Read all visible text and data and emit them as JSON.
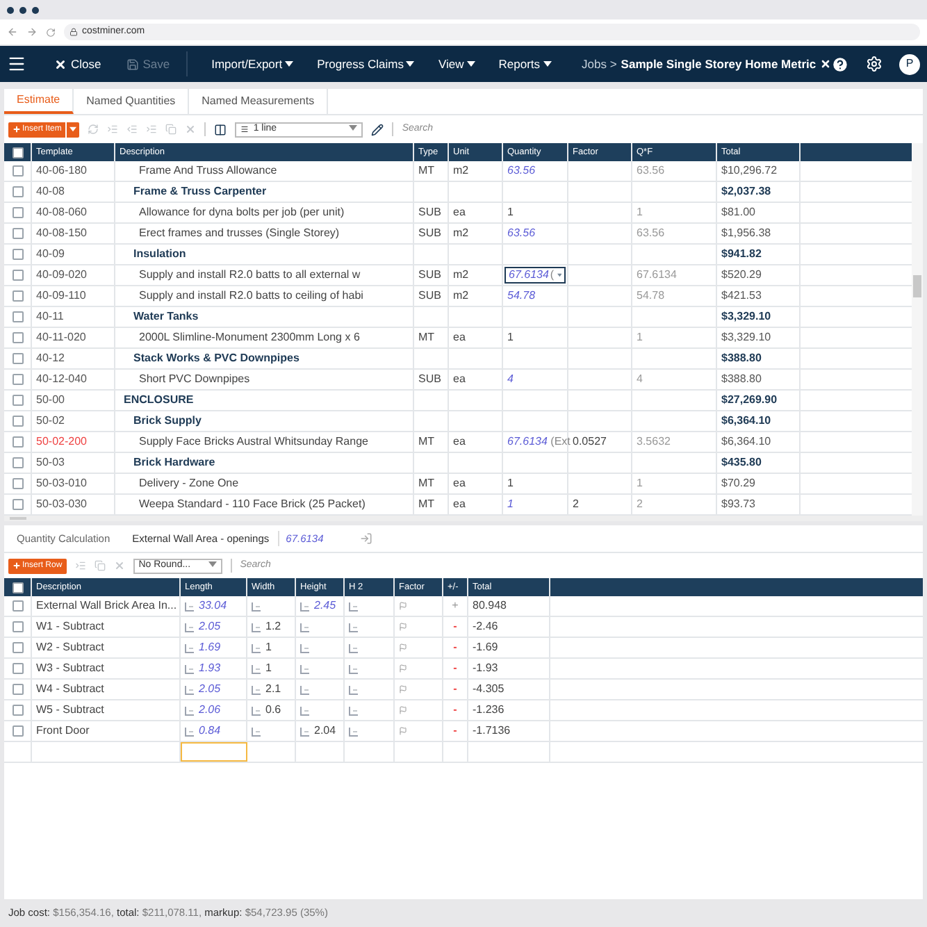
{
  "browser": {
    "url": "costminer.com"
  },
  "nav": {
    "close": "Close",
    "save": "Save",
    "save_disabled": true,
    "menus": [
      "Import/Export",
      "Progress Claims",
      "View",
      "Reports"
    ],
    "breadcrumb": "Jobs >",
    "job_title": "Sample Single Storey Home Metric",
    "avatar": "P"
  },
  "tabs": [
    {
      "label": "Estimate",
      "selected": true
    },
    {
      "label": "Named Quantities",
      "selected": false
    },
    {
      "label": "Named Measurements",
      "selected": false
    }
  ],
  "toolbar": {
    "insert": "Insert Item",
    "lines": "1 line",
    "search": {
      "placeholder": "Search"
    }
  },
  "table": {
    "columns": [
      "Template",
      "Description",
      "Type",
      "Unit",
      "Quantity",
      "Factor",
      "Q*F",
      "Total"
    ],
    "select_all_checked": false,
    "rows": [
      {
        "kind": "item",
        "checked": false,
        "template": "40-06-180",
        "description": "Frame And Truss Allowance",
        "type": "MT",
        "unit": "m2",
        "quantity": "63.56",
        "linked": true,
        "qf": "63.56",
        "total": "$10,296.72",
        "flagged": false,
        "editing": false
      },
      {
        "kind": "group",
        "checked": false,
        "template": "40-08",
        "description": "Frame & Truss Carpenter",
        "total": "$2,037.38",
        "flagged": false
      },
      {
        "kind": "item",
        "checked": false,
        "template": "40-08-060",
        "description": "Allowance for dyna bolts per job (per unit)",
        "type": "SUB",
        "unit": "ea",
        "quantity": "1",
        "linked": false,
        "qf": "1",
        "total": "$81.00",
        "flagged": false,
        "editing": false
      },
      {
        "kind": "item",
        "checked": false,
        "template": "40-08-150",
        "description": "Erect frames and trusses (Single Storey)",
        "type": "SUB",
        "unit": "m2",
        "quantity": "63.56",
        "linked": true,
        "qf": "63.56",
        "total": "$1,956.38",
        "flagged": false,
        "editing": false
      },
      {
        "kind": "group",
        "checked": false,
        "template": "40-09",
        "description": "Insulation",
        "total": "$941.82",
        "flagged": false
      },
      {
        "kind": "item",
        "checked": false,
        "template": "40-09-020",
        "description": "Supply and install R2.0 batts to all external w",
        "type": "SUB",
        "unit": "m2",
        "quantity": "67.6134",
        "quantity_note": "(",
        "linked": true,
        "qf": "67.6134",
        "total": "$520.29",
        "flagged": false,
        "editing": true
      },
      {
        "kind": "item",
        "checked": false,
        "template": "40-09-110",
        "description": "Supply and install R2.0 batts to ceiling of habi",
        "type": "SUB",
        "unit": "m2",
        "quantity": "54.78",
        "linked": true,
        "qf": "54.78",
        "total": "$421.53",
        "flagged": false,
        "editing": false
      },
      {
        "kind": "group",
        "checked": false,
        "template": "40-11",
        "description": "Water Tanks",
        "total": "$3,329.10",
        "flagged": false
      },
      {
        "kind": "item",
        "checked": false,
        "template": "40-11-020",
        "description": "2000L Slimline-Monument 2300mm Long x 6",
        "type": "MT",
        "unit": "ea",
        "quantity": "1",
        "linked": false,
        "qf": "1",
        "total": "$3,329.10",
        "flagged": false,
        "editing": false
      },
      {
        "kind": "group",
        "checked": false,
        "template": "40-12",
        "description": "Stack Works & PVC Downpipes",
        "total": "$388.80",
        "flagged": false
      },
      {
        "kind": "item",
        "checked": false,
        "template": "40-12-040",
        "description": "Short PVC Downpipes",
        "type": "SUB",
        "unit": "ea",
        "quantity": "4",
        "linked": true,
        "qf": "4",
        "total": "$388.80",
        "flagged": false,
        "editing": false
      },
      {
        "kind": "section",
        "checked": false,
        "template": "50-00",
        "description": "ENCLOSURE",
        "total": "$27,269.90",
        "flagged": false
      },
      {
        "kind": "group",
        "checked": false,
        "template": "50-02",
        "description": "Brick Supply",
        "total": "$6,364.10",
        "flagged": false
      },
      {
        "kind": "item",
        "checked": false,
        "template": "50-02-200",
        "description": "Supply Face Bricks Austral Whitsunday Range",
        "type": "MT",
        "unit": "ea",
        "quantity": "67.6134",
        "quantity_note": "(Ext",
        "linked": true,
        "factor": "0.0527",
        "qf": "3.5632",
        "total": "$6,364.10",
        "flagged": true,
        "editing": false
      },
      {
        "kind": "group",
        "checked": false,
        "template": "50-03",
        "description": "Brick Hardware",
        "total": "$435.80",
        "flagged": false
      },
      {
        "kind": "item",
        "checked": false,
        "template": "50-03-010",
        "description": "Delivery - Zone One",
        "type": "MT",
        "unit": "ea",
        "quantity": "1",
        "linked": false,
        "qf": "1",
        "total": "$70.29",
        "flagged": false,
        "editing": false
      },
      {
        "kind": "item",
        "checked": false,
        "template": "50-03-030",
        "description": "Weepa Standard - 110 Face Brick (25 Packet)",
        "type": "MT",
        "unit": "ea",
        "quantity": "1",
        "linked": true,
        "factor": "2",
        "qf": "2",
        "total": "$93.73",
        "flagged": false,
        "editing": false
      }
    ]
  },
  "calc": {
    "title": "Quantity Calculation",
    "item": "External Wall Area - openings",
    "value": "67.6134",
    "insert": "Insert Row",
    "rounding": "No Round...",
    "search": {
      "placeholder": "Search"
    },
    "columns": [
      "Description",
      "Length",
      "Width",
      "Height",
      "H 2",
      "Factor",
      "+/-",
      "Total"
    ],
    "select_all_checked": false,
    "rows": [
      {
        "checked": false,
        "description": "External Wall Brick Area In...",
        "length": {
          "value": "33.04",
          "linked": true
        },
        "width": {},
        "height": {
          "value": "2.45",
          "linked": true
        },
        "sign": "+",
        "negative": false,
        "total": "80.948"
      },
      {
        "checked": false,
        "description": "W1 - Subtract",
        "length": {
          "value": "2.05",
          "linked": true
        },
        "width": {
          "value": "1.2",
          "linked": false
        },
        "height": {},
        "sign": "-",
        "negative": true,
        "total": "-2.46"
      },
      {
        "checked": false,
        "description": "W2 - Subtract",
        "length": {
          "value": "1.69",
          "linked": true
        },
        "width": {
          "value": "1",
          "linked": false
        },
        "height": {},
        "sign": "-",
        "negative": true,
        "total": "-1.69"
      },
      {
        "checked": false,
        "description": "W3 - Subtract",
        "length": {
          "value": "1.93",
          "linked": true
        },
        "width": {
          "value": "1",
          "linked": false
        },
        "height": {},
        "sign": "-",
        "negative": true,
        "total": "-1.93"
      },
      {
        "checked": false,
        "description": "W4 - Subtract",
        "length": {
          "value": "2.05",
          "linked": true
        },
        "width": {
          "value": "2.1",
          "linked": false
        },
        "height": {},
        "sign": "-",
        "negative": true,
        "total": "-4.305"
      },
      {
        "checked": false,
        "description": "W5 - Subtract",
        "length": {
          "value": "2.06",
          "linked": true
        },
        "width": {
          "value": "0.6",
          "linked": false
        },
        "height": {},
        "sign": "-",
        "negative": true,
        "total": "-1.236"
      },
      {
        "checked": false,
        "description": "Front Door",
        "length": {
          "value": "0.84",
          "linked": true
        },
        "width": {},
        "height": {
          "value": "2.04",
          "linked": false
        },
        "sign": "-",
        "negative": true,
        "total": "-1.7136"
      }
    ],
    "new_row": {
      "length_focused": true
    }
  },
  "status_bar": [
    {
      "label": "Job cost:",
      "value": "$156,354.16,"
    },
    {
      "label": "total:",
      "value": "$211,078.11,"
    },
    {
      "label": "markup:",
      "value": "$54,723.95 (35%)"
    }
  ]
}
